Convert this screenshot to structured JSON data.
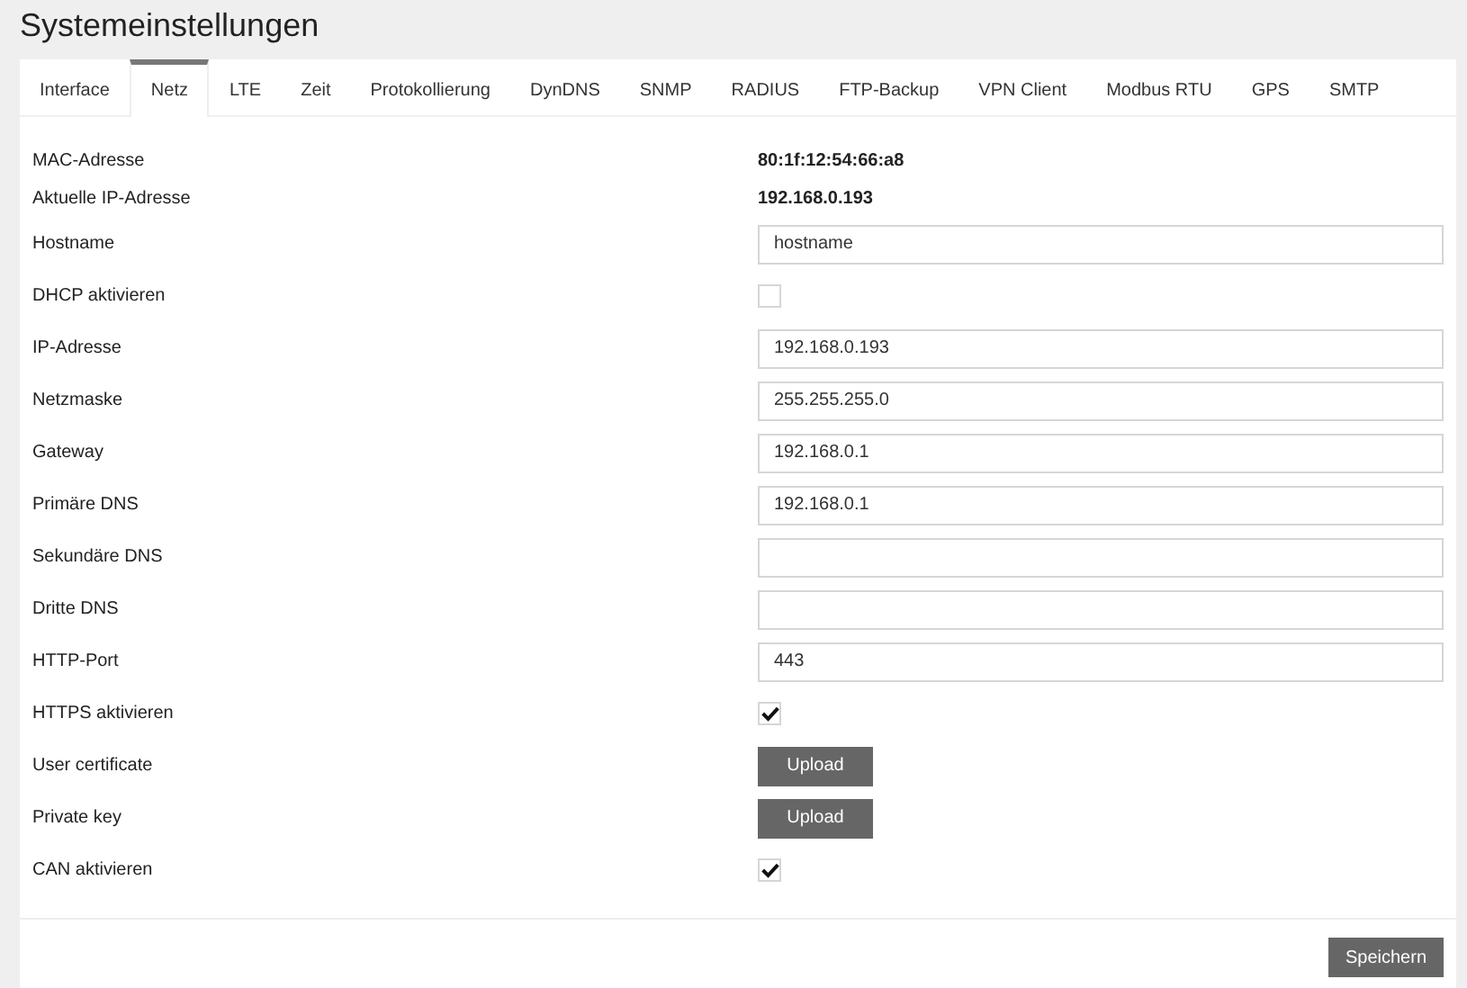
{
  "title": "Systemeinstellungen",
  "tabs": [
    {
      "label": "Interface",
      "selected": false
    },
    {
      "label": "Netz",
      "selected": true
    },
    {
      "label": "LTE",
      "selected": false
    },
    {
      "label": "Zeit",
      "selected": false
    },
    {
      "label": "Protokollierung",
      "selected": false
    },
    {
      "label": "DynDNS",
      "selected": false
    },
    {
      "label": "SNMP",
      "selected": false
    },
    {
      "label": "RADIUS",
      "selected": false
    },
    {
      "label": "FTP-Backup",
      "selected": false
    },
    {
      "label": "VPN Client",
      "selected": false
    },
    {
      "label": "Modbus RTU",
      "selected": false
    },
    {
      "label": "GPS",
      "selected": false
    },
    {
      "label": "SMTP",
      "selected": false
    }
  ],
  "fields": [
    {
      "kind": "text",
      "label": "MAC-Adresse",
      "value": "80:1f:12:54:66:a8"
    },
    {
      "kind": "text",
      "label": "Aktuelle IP-Adresse",
      "value": "192.168.0.193"
    },
    {
      "kind": "input",
      "label": "Hostname",
      "value": "hostname"
    },
    {
      "kind": "checkbox",
      "label": "DHCP aktivieren",
      "checked": false
    },
    {
      "kind": "input",
      "label": "IP-Adresse",
      "value": "192.168.0.193"
    },
    {
      "kind": "input",
      "label": "Netzmaske",
      "value": "255.255.255.0"
    },
    {
      "kind": "input",
      "label": "Gateway",
      "value": "192.168.0.1"
    },
    {
      "kind": "input",
      "label": "Primäre DNS",
      "value": "192.168.0.1"
    },
    {
      "kind": "input",
      "label": "Sekundäre DNS"
    },
    {
      "kind": "input",
      "label": "Dritte DNS"
    },
    {
      "kind": "input",
      "label": "HTTP-Port",
      "value": "443"
    },
    {
      "kind": "checkbox",
      "label": "HTTPS aktivieren",
      "checked": true
    },
    {
      "kind": "button",
      "label": "User certificate",
      "button": "Upload"
    },
    {
      "kind": "button",
      "label": "Private key",
      "button": "Upload"
    },
    {
      "kind": "checkbox",
      "label": "CAN aktivieren",
      "checked": true
    }
  ],
  "save_button": "Speichern"
}
